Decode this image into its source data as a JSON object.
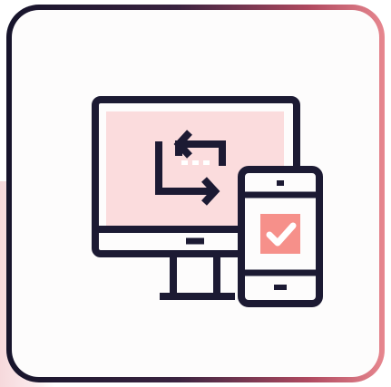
{
  "icon": {
    "name": "desktop-mobile-sync-icon",
    "colors": {
      "stroke": "#1c1a33",
      "screen_fill": "#fbdcdd",
      "check_fill": "#f6908a",
      "check_mark": "#ffffff",
      "frame_gradient_start": "#16142b",
      "frame_gradient_end": "#e7878f",
      "background": "#fdfcfc"
    }
  }
}
